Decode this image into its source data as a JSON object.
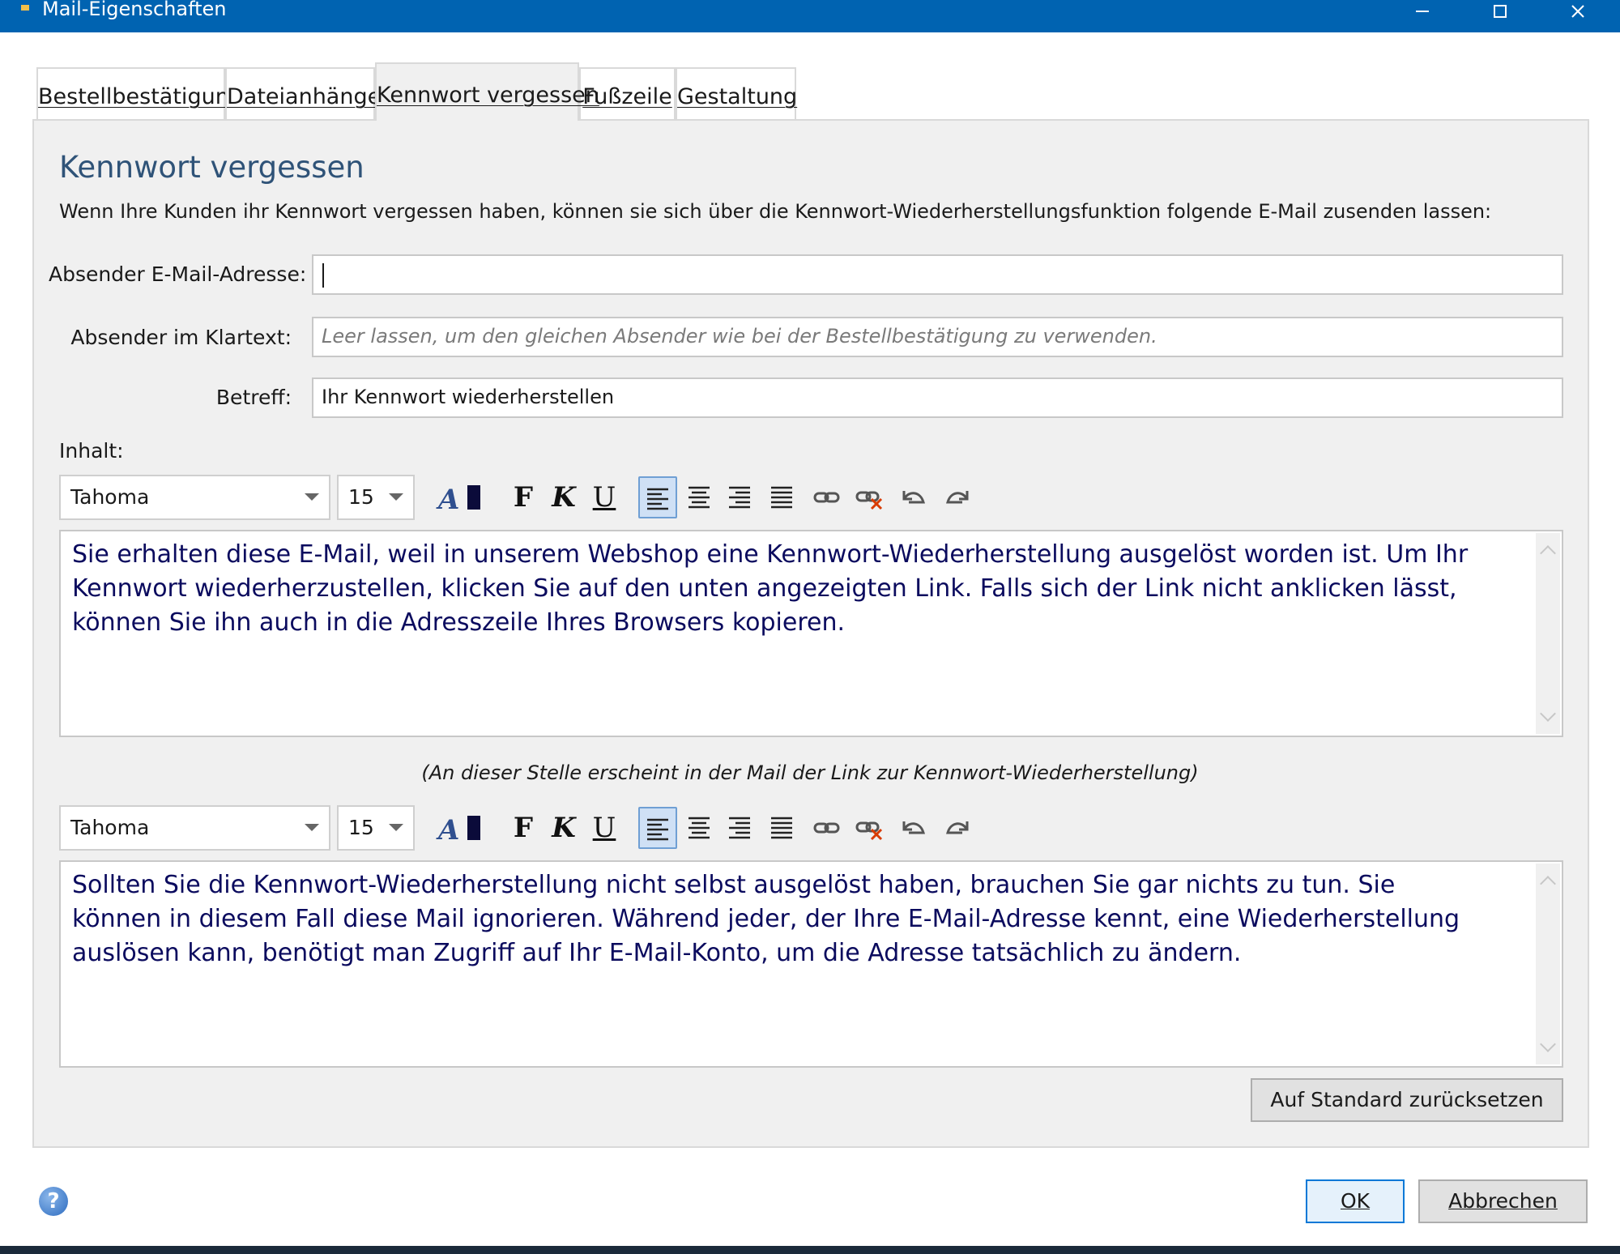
{
  "window": {
    "title": "Mail-Eigenschaften",
    "minimize_glyph": "—",
    "accent_color": "#0063b1"
  },
  "tabs": [
    {
      "label": "Bestellbestätigung",
      "active": false
    },
    {
      "label": "Dateianhänge",
      "active": false
    },
    {
      "label": "Kennwort vergessen",
      "active": true
    },
    {
      "label": "Fußzeile",
      "active": false
    },
    {
      "label": "Gestaltung",
      "active": false
    }
  ],
  "section": {
    "title": "Kennwort vergessen",
    "intro": "Wenn Ihre Kunden ihr Kennwort vergessen haben, können sie sich über die Kennwort-Wiederherstellungsfunktion folgende E-Mail zusenden lassen:"
  },
  "fields": {
    "sender_email": {
      "label": "Absender E-Mail-Adresse:",
      "value": ""
    },
    "sender_plain": {
      "label": "Absender im Klartext:",
      "value": "",
      "placeholder": "Leer lassen, um den gleichen Absender wie bei der Bestellbestätigung zu verwenden."
    },
    "subject": {
      "label": "Betreff:",
      "value": "Ihr Kennwort wiederherstellen"
    }
  },
  "content_label": "Inhalt:",
  "toolbar1": {
    "font": "Tahoma",
    "size": "15"
  },
  "editor1": {
    "text": "Sie erhalten diese E-Mail, weil in unserem Webshop eine Kennwort-Wiederherstellung ausgelöst worden ist. Um Ihr Kennwort wiederherzustellen, klicken Sie auf den unten angezeigten Link. Falls sich der Link nicht anklicken lässt, können Sie ihn auch in die Adresszeile Ihres Browsers kopieren."
  },
  "link_hint": "(An dieser Stelle erscheint in der Mail der Link zur Kennwort-Wiederherstellung)",
  "toolbar2": {
    "font": "Tahoma",
    "size": "15"
  },
  "editor2": {
    "text": "Sollten Sie die Kennwort-Wiederherstellung nicht selbst ausgelöst haben, brauchen Sie gar nichts zu tun. Sie können in diesem Fall diese Mail ignorieren. Während jeder, der Ihre E-Mail-Adresse kennt, eine Wiederherstellung auslösen kann, benötigt man Zugriff auf Ihr E-Mail-Konto, um die Adresse tatsächlich zu ändern."
  },
  "toolbar_glyphs": {
    "font_color": "A",
    "bold": "F",
    "italic": "K",
    "underline": "U"
  },
  "buttons": {
    "reset": "Auf Standard zurücksetzen",
    "ok": "OK",
    "cancel": "Abbrechen",
    "help": "?"
  },
  "icons": [
    "help-icon",
    "font-color-icon",
    "align-left-icon",
    "align-center-icon",
    "align-right-icon",
    "align-justify-icon",
    "link-icon",
    "unlink-icon",
    "undo-icon",
    "redo-icon",
    "minimize-icon",
    "maximize-icon",
    "close-icon"
  ]
}
